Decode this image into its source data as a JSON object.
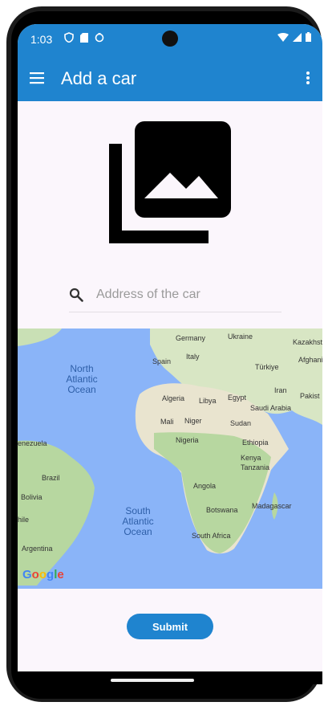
{
  "status_bar": {
    "time": "1:03"
  },
  "app_bar": {
    "title": "Add a car"
  },
  "search": {
    "placeholder": "Address of the car"
  },
  "map": {
    "ocean_labels": [
      "North\nAtlantic\nOcean",
      "South\nAtlantic\nOcean"
    ],
    "places": [
      "Germany",
      "Ukraine",
      "Kazakhst",
      "Spain",
      "Italy",
      "Türkiye",
      "Afghanis",
      "Iran",
      "Pakist",
      "Algeria",
      "Libya",
      "Egypt",
      "Saudi Arabia",
      "Mali",
      "Niger",
      "Sudan",
      "Nigeria",
      "Ethiopia",
      "enezuela",
      "Kenya",
      "Tanzania",
      "Brazil",
      "Angola",
      "Bolivia",
      "Madagascar",
      "Botswana",
      "hile",
      "South Africa",
      "Argentina"
    ],
    "attribution": "Google"
  },
  "actions": {
    "submit_label": "Submit"
  },
  "colors": {
    "accent": "#1f84cf",
    "background": "#fbf6fc",
    "ocean": "#8ab4f8",
    "land": "#b7d7a0"
  }
}
